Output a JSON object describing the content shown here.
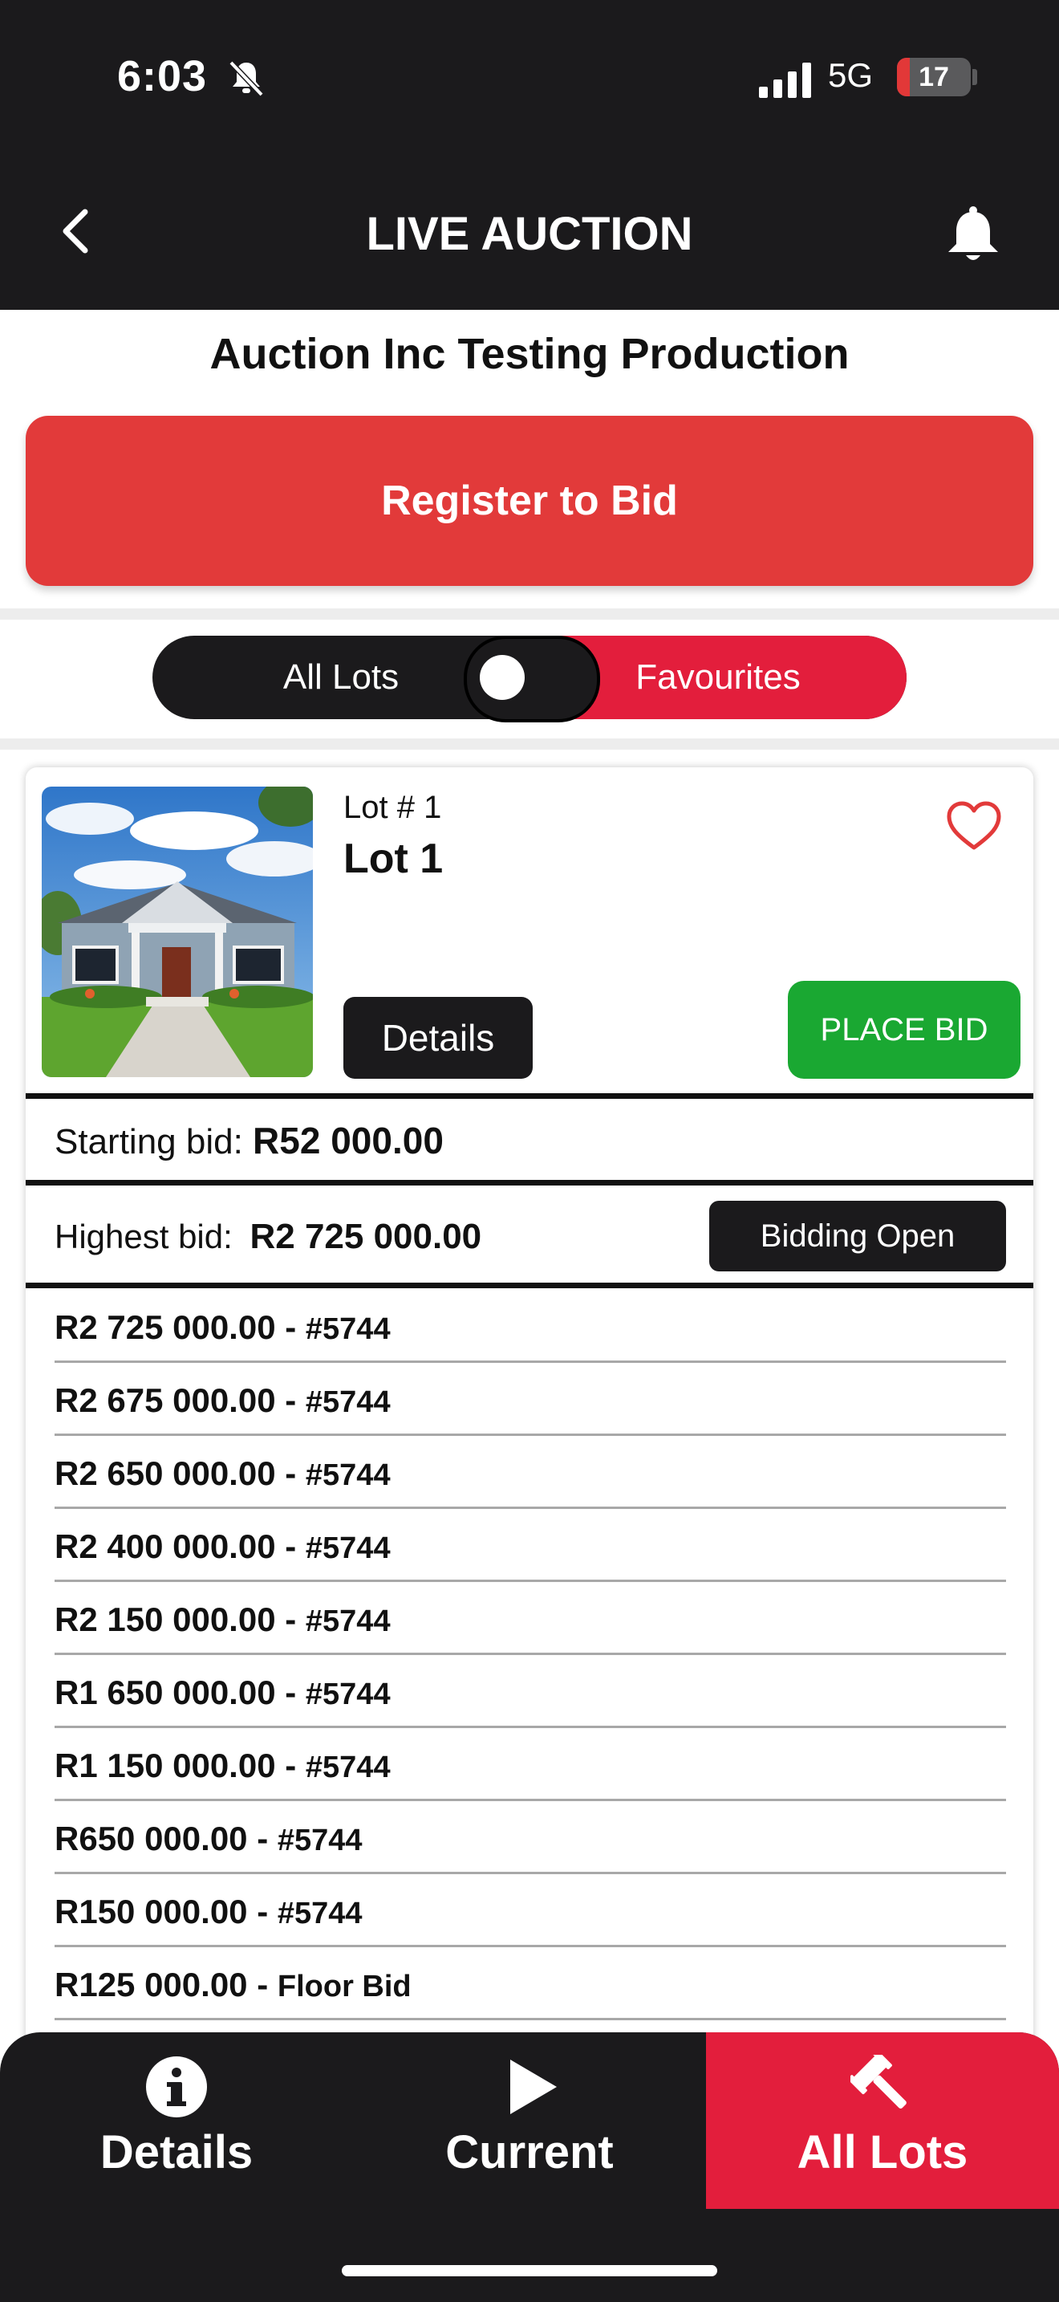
{
  "status_bar": {
    "time": "6:03",
    "network": "5G",
    "battery": "17",
    "battery_level": 0.17
  },
  "header": {
    "title": "LIVE AUCTION",
    "back_icon": "chevron-left-icon",
    "bell_icon": "bell-icon"
  },
  "auction": {
    "name": "Auction Inc Testing Production"
  },
  "register_button": {
    "label": "Register to Bid"
  },
  "toggle": {
    "left_label": "All Lots",
    "right_label": "Favourites"
  },
  "lot": {
    "number_label": "Lot # 1",
    "title": "Lot 1",
    "details_label": "Details",
    "place_bid_label": "PLACE BID",
    "starting_bid_label": "Starting bid:",
    "starting_bid_value": "R52 000.00",
    "highest_bid_label": "Highest bid:",
    "highest_bid_value": "R2 725 000.00",
    "status_label": "Bidding Open",
    "bids": [
      {
        "amount": "R2 725 000.00",
        "bidder": "#5744"
      },
      {
        "amount": "R2 675 000.00",
        "bidder": "#5744"
      },
      {
        "amount": "R2 650 000.00",
        "bidder": "#5744"
      },
      {
        "amount": "R2 400 000.00",
        "bidder": "#5744"
      },
      {
        "amount": "R2 150 000.00",
        "bidder": "#5744"
      },
      {
        "amount": "R1 650 000.00",
        "bidder": "#5744"
      },
      {
        "amount": "R1 150 000.00",
        "bidder": "#5744"
      },
      {
        "amount": "R650 000.00",
        "bidder": "#5744"
      },
      {
        "amount": "R150 000.00",
        "bidder": "#5744"
      },
      {
        "amount": "R125 000.00",
        "bidder": "Floor Bid"
      }
    ]
  },
  "bottom_nav": {
    "items": [
      {
        "label": "Details",
        "icon": "info-icon"
      },
      {
        "label": "Current",
        "icon": "play-icon"
      },
      {
        "label": "All Lots",
        "icon": "gavel-icon"
      }
    ],
    "active": "All Lots"
  },
  "colors": {
    "dark": "#1b1a1c",
    "accent_red": "#e23a3a",
    "toggle_red": "#e31e3c",
    "green": "#1aa832"
  }
}
